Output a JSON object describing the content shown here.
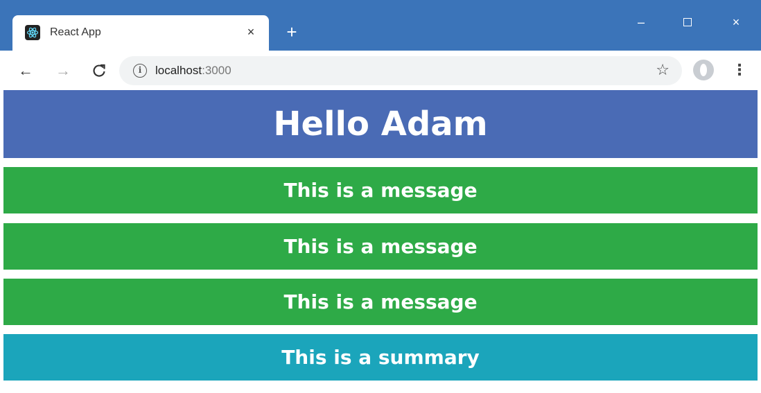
{
  "browser": {
    "tab": {
      "title": "React App",
      "favicon": "react-icon",
      "close": "×"
    },
    "new_tab": "+",
    "window_controls": {
      "minimize": "–",
      "close": "×"
    },
    "nav": {
      "back": "←",
      "forward": "→",
      "reload": "C"
    },
    "address": {
      "info": "i",
      "host": "localhost",
      "port": ":3000"
    },
    "bookmark_star": "☆",
    "menu": "⋮"
  },
  "page": {
    "header": "Hello Adam",
    "messages": [
      "This is a message",
      "This is a message",
      "This is a message"
    ],
    "summary": "This is a summary"
  },
  "colors": {
    "titlebar": "#3b74b9",
    "header": "#4a6bb5",
    "message": "#2eaa47",
    "summary": "#1ba5bb"
  }
}
